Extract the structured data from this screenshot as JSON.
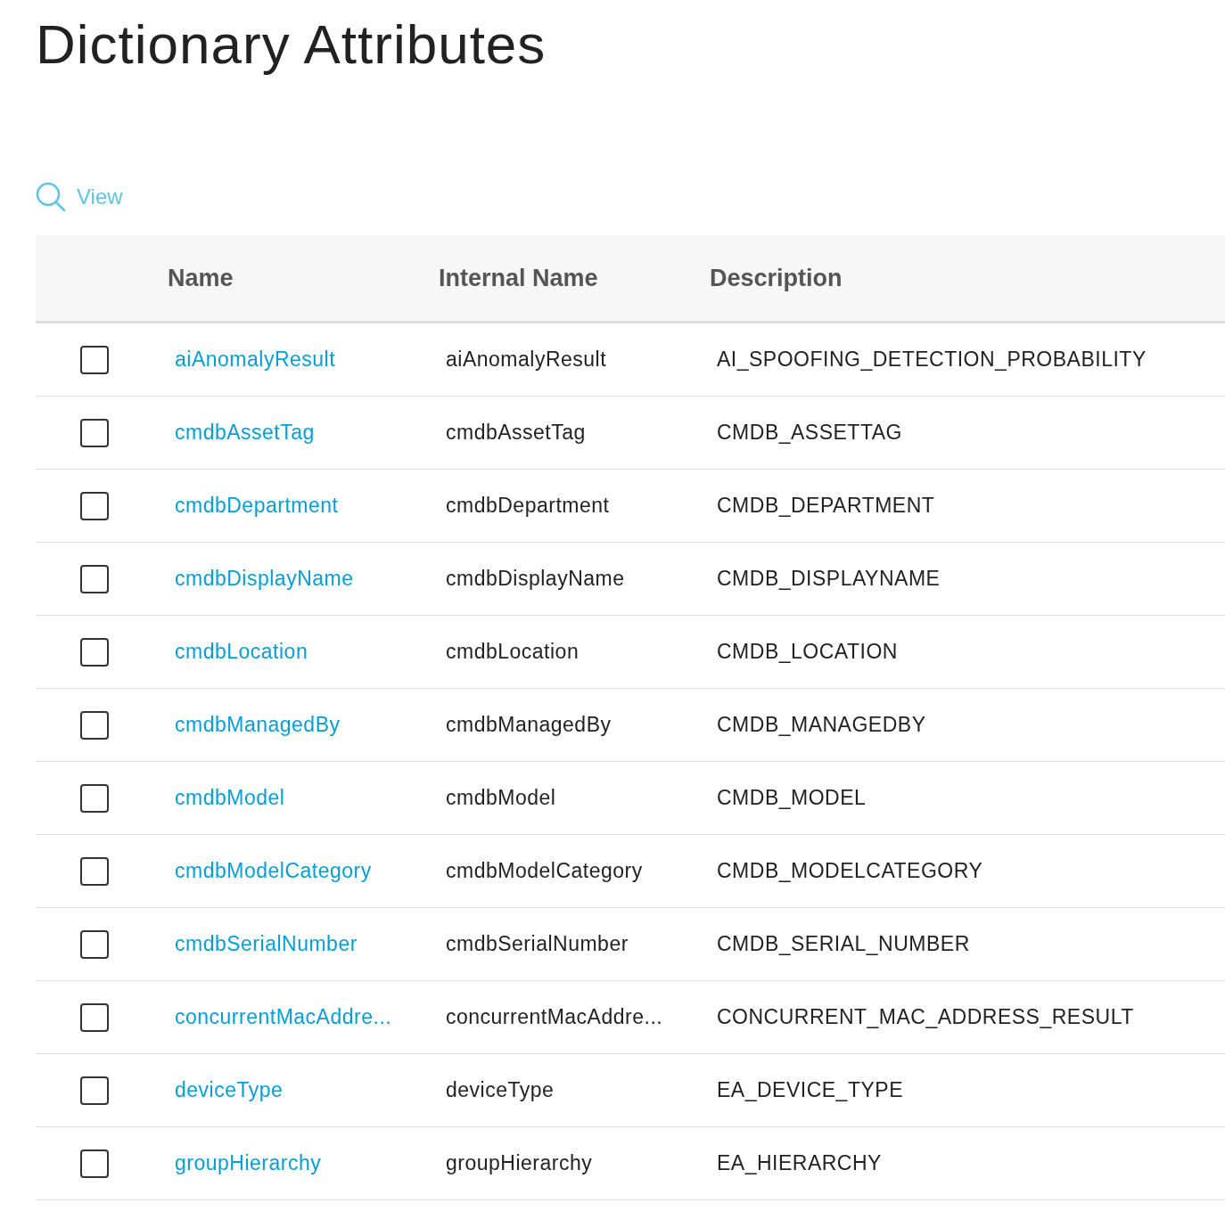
{
  "page_title": "Dictionary Attributes",
  "view_link": "View",
  "table": {
    "columns": [
      "Name",
      "Internal Name",
      "Description"
    ],
    "rows": [
      {
        "checked": false,
        "name": "aiAnomalyResult",
        "internal_name": "aiAnomalyResult",
        "description": "AI_SPOOFING_DETECTION_PROBABILITY"
      },
      {
        "checked": false,
        "name": "cmdbAssetTag",
        "internal_name": "cmdbAssetTag",
        "description": "CMDB_ASSETTAG"
      },
      {
        "checked": false,
        "name": "cmdbDepartment",
        "internal_name": "cmdbDepartment",
        "description": "CMDB_DEPARTMENT"
      },
      {
        "checked": false,
        "name": "cmdbDisplayName",
        "internal_name": "cmdbDisplayName",
        "description": "CMDB_DISPLAYNAME"
      },
      {
        "checked": false,
        "name": "cmdbLocation",
        "internal_name": "cmdbLocation",
        "description": "CMDB_LOCATION"
      },
      {
        "checked": false,
        "name": "cmdbManagedBy",
        "internal_name": "cmdbManagedBy",
        "description": "CMDB_MANAGEDBY"
      },
      {
        "checked": false,
        "name": "cmdbModel",
        "internal_name": "cmdbModel",
        "description": "CMDB_MODEL"
      },
      {
        "checked": false,
        "name": "cmdbModelCategory",
        "internal_name": "cmdbModelCategory",
        "description": "CMDB_MODELCATEGORY"
      },
      {
        "checked": false,
        "name": "cmdbSerialNumber",
        "internal_name": "cmdbSerialNumber",
        "description": "CMDB_SERIAL_NUMBER"
      },
      {
        "checked": false,
        "name": "concurrentMacAddre...",
        "internal_name": "concurrentMacAddre...",
        "description": "CONCURRENT_MAC_ADDRESS_RESULT"
      },
      {
        "checked": false,
        "name": "deviceType",
        "internal_name": "deviceType",
        "description": "EA_DEVICE_TYPE"
      },
      {
        "checked": false,
        "name": "groupHierarchy",
        "internal_name": "groupHierarchy",
        "description": "EA_HIERARCHY"
      }
    ]
  }
}
